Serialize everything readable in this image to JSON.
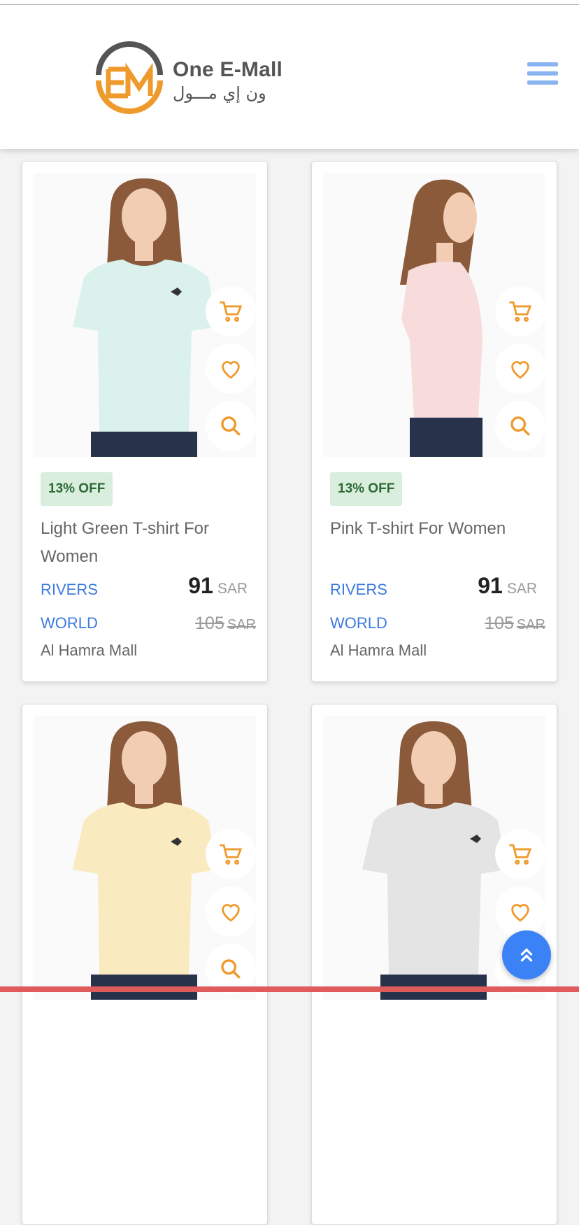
{
  "header": {
    "logo_name": "One E-Mall",
    "logo_sub": "ون إي مـــول"
  },
  "colors": {
    "accent_orange": "#ef9a2d",
    "link_blue": "#3d7be0",
    "badge_bg": "#d9eedc",
    "scroll_button": "#3b82f6"
  },
  "products": [
    {
      "discount": "13% OFF",
      "title": "Light Green T-shirt For Women",
      "brand_line1": "RIVERS",
      "brand_line2": "WORLD",
      "price": "91",
      "currency": "SAR",
      "old_price": "105",
      "mall": "Al Hamra Mall",
      "shirt_color": "#daf1ec",
      "icons": [
        "cart-icon",
        "heart-icon",
        "search-icon"
      ]
    },
    {
      "discount": "13% OFF",
      "title": "Pink T-shirt For Women",
      "brand_line1": "RIVERS",
      "brand_line2": "WORLD",
      "price": "91",
      "currency": "SAR",
      "old_price": "105",
      "mall": "Al Hamra Mall",
      "shirt_color": "#f8dcdc",
      "icons": [
        "cart-icon",
        "heart-icon",
        "search-icon"
      ]
    },
    {
      "shirt_color": "#faeabf",
      "icons": [
        "cart-icon",
        "heart-icon",
        "search-icon"
      ]
    },
    {
      "shirt_color": "#e4e4e4",
      "icons": [
        "cart-icon",
        "heart-icon",
        "search-icon"
      ]
    }
  ],
  "floating": {
    "scroll_top_icon": "double-chevron-up-icon"
  }
}
